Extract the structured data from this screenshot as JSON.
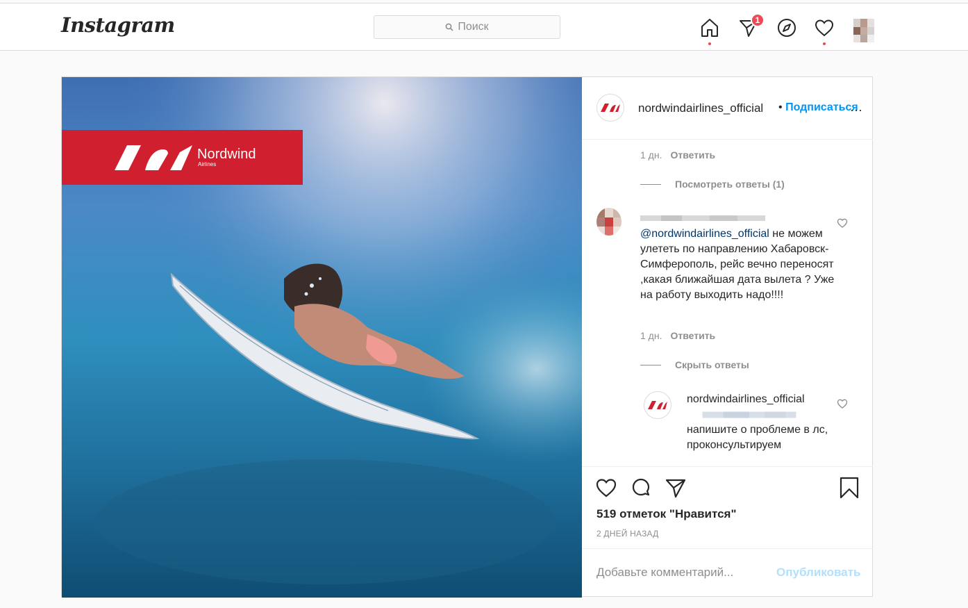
{
  "header": {
    "logo": "Instagram",
    "search_placeholder": "Поиск",
    "badge_count": "1",
    "icons": [
      "home-icon",
      "direct-icon",
      "explore-icon",
      "activity-heart-icon",
      "profile-avatar"
    ]
  },
  "post": {
    "brand_label": "Nordwind",
    "brand_sublabel": "Airlines",
    "account": "nordwindairlines_official",
    "follow_separator": "•",
    "follow_label": "Подписаться",
    "comments": [
      {
        "time": "1 дн.",
        "reply_label": "Ответить",
        "view_replies": "Посмотреть ответы (1)"
      },
      {
        "mention": "@nordwindairlines_official",
        "text": " не можем улететь по направлению Хабаровск-Симферополь, рейс вечно переносят ,какая ближайшая дата вылета ? Уже на работу выходить надо!!!!",
        "time": "1 дн.",
        "reply_label": "Ответить",
        "hide_replies": "Скрыть ответы"
      },
      {
        "author": "nordwindairlines_official",
        "text": "напишите о проблеме в лс, проконсультируем"
      }
    ],
    "likes": "519 отметок \"Нравится\"",
    "posted": "2 ДНЕЙ НАЗАД",
    "comment_placeholder": "Добавьте комментарий...",
    "publish_label": "Опубликовать"
  },
  "colors": {
    "brand_red": "#d01f2e",
    "link_blue": "#0095f6",
    "notification_red": "#ed4956",
    "mention": "#00376b"
  }
}
